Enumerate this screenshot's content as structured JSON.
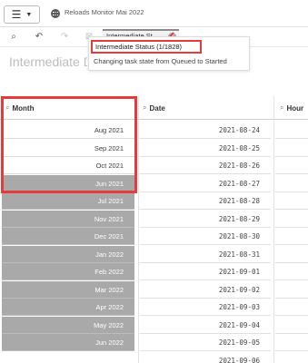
{
  "header": {
    "app_title": "Reloads Monitor Mai 2022",
    "menu_icon": "hamburger-icon",
    "app_icon": "app-icon"
  },
  "toolbar": {
    "icons": [
      "smart-search-icon",
      "lasso-select-icon",
      "step-back-icon",
      "step-forward-icon"
    ],
    "selection_pill_label": "Intermediate St...",
    "selection_pill_close_icon": "close-icon"
  },
  "popup": {
    "item_label": "Intermediate Status (1/1828)",
    "item_value": "Changing task state from Queued to Started"
  },
  "sheet": {
    "title": "Intermediate D"
  },
  "table": {
    "columns": [
      {
        "label": "Month"
      },
      {
        "label": "Date"
      },
      {
        "label": "Hour"
      }
    ],
    "rows": [
      {
        "month": "Aug 2021",
        "month_state": "selected",
        "date": "2021-08-24"
      },
      {
        "month": "Sep 2021",
        "month_state": "selected",
        "date": "2021-08-25"
      },
      {
        "month": "Oct 2021",
        "month_state": "selected",
        "date": "2021-08-26"
      },
      {
        "month": "Jun 2021",
        "month_state": "excluded",
        "date": "2021-08-27"
      },
      {
        "month": "Jul 2021",
        "month_state": "excluded",
        "date": "2021-08-28"
      },
      {
        "month": "Nov 2021",
        "month_state": "excluded",
        "date": "2021-08-29"
      },
      {
        "month": "Dec 2021",
        "month_state": "excluded",
        "date": "2021-08-30"
      },
      {
        "month": "Jan 2022",
        "month_state": "excluded",
        "date": "2021-08-31"
      },
      {
        "month": "Feb 2022",
        "month_state": "excluded",
        "date": "2021-09-01"
      },
      {
        "month": "Mar 2022",
        "month_state": "excluded",
        "date": "2021-09-02"
      },
      {
        "month": "Apr 2022",
        "month_state": "excluded",
        "date": "2021-09-03"
      },
      {
        "month": "May 2022",
        "month_state": "excluded",
        "date": "2021-09-04"
      },
      {
        "month": "Jun 2022",
        "month_state": "excluded",
        "date": "2021-09-05"
      },
      {
        "month": "",
        "month_state": "",
        "date": "2021-09-06"
      }
    ]
  },
  "colors": {
    "highlight_red": "#e23c3c",
    "excluded_grey": "#a9a9a9",
    "selected_white": "#ffffff"
  }
}
